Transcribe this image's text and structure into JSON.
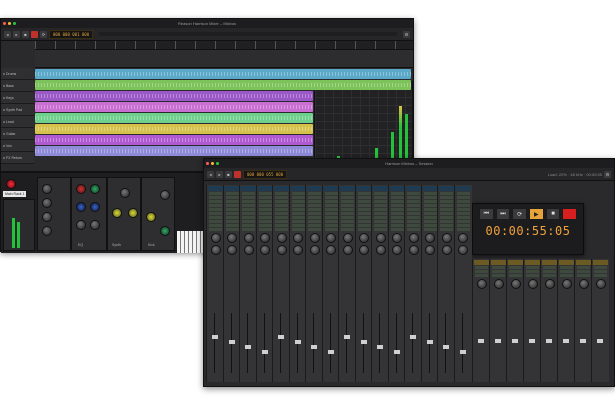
{
  "back_window": {
    "title": "Reason Harrison Mixer – Mixbus",
    "counter": "000 000 001 000",
    "track_names": [
      "Drums",
      "Bass",
      "Keys",
      "Synth Pad",
      "Lead",
      "Guitar",
      "Vox",
      "FX Return"
    ],
    "lane_colors": [
      "#5aa9c8",
      "#7cc35a",
      "#9b59c8",
      "#c86fd1",
      "#6fcf8c",
      "#d4c24d",
      "#b05ad2",
      "#8e8bd9"
    ],
    "rack_labels": [
      "Audio Track",
      "Mixer",
      "EQ",
      "Synth",
      "Kick"
    ],
    "rack_title": "Main Rack 1"
  },
  "front_window": {
    "title": "Harrison Mixbus – Session",
    "counter": "000 000 055 000",
    "status_text": "Load: 22% · 48 kHz · 00:00:55",
    "transport_time": "00:00:55:05",
    "transport_buttons": [
      "⏮",
      "⏭",
      "⟳",
      "▶",
      "■",
      "●"
    ],
    "channel_count": 16,
    "bus_count": 8
  }
}
